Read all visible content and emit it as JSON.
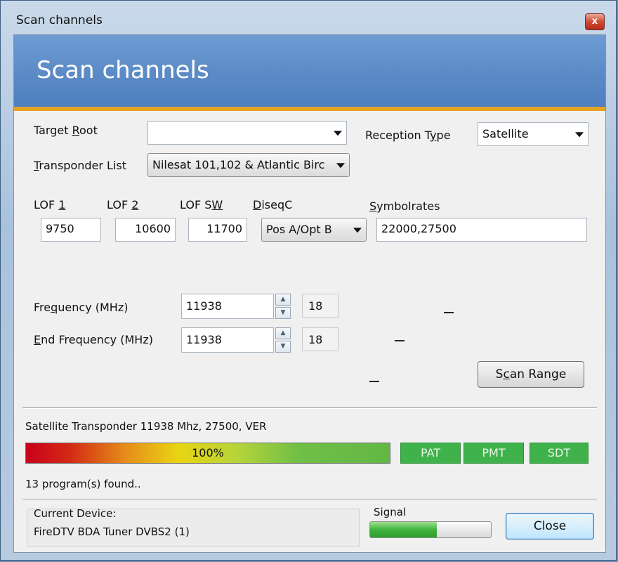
{
  "window": {
    "title": "Scan channels",
    "close_glyph": "x"
  },
  "banner": {
    "title": "Scan channels"
  },
  "target_root": {
    "label_pre": "Target ",
    "label_acc": "R",
    "label_post": "oot",
    "value": ""
  },
  "reception_type": {
    "label_pre": "Reception T",
    "label_acc": "y",
    "label_post": "pe",
    "value": "Satellite"
  },
  "transponder_list": {
    "label_pre": "",
    "label_acc": "T",
    "label_post": "ransponder List",
    "value": "Nilesat 101,102 & Atlantic Birc"
  },
  "lof1": {
    "label_pre": "LOF ",
    "label_acc": "1",
    "label_post": "",
    "value": "9750"
  },
  "lof2": {
    "label_pre": "LOF ",
    "label_acc": "2",
    "label_post": "",
    "value": "10600"
  },
  "lofsw": {
    "label_pre": "LOF S",
    "label_acc": "W",
    "label_post": "",
    "value": "11700"
  },
  "diseqc": {
    "label_pre": "",
    "label_acc": "D",
    "label_post": "iseqC",
    "value": "Pos A/Opt B"
  },
  "symbolrates": {
    "label_pre": "",
    "label_acc": "S",
    "label_post": "ymbolrates",
    "value": "22000,27500"
  },
  "frequency": {
    "label_pre": "Fre",
    "label_acc": "q",
    "label_post": "uency (MHz)",
    "value": "11938",
    "side_value": "18"
  },
  "end_frequency": {
    "label_pre": "",
    "label_acc": "E",
    "label_post": "nd  Frequency (MHz)",
    "value": "11938",
    "side_value": "18"
  },
  "dash_text": "–",
  "scan_range": {
    "label_pre": "S",
    "label_acc": "c",
    "label_post": "an Range"
  },
  "status": {
    "transponder_text": "Satellite Transponder 11938 Mhz, 27500, VER",
    "progress_label": "100%",
    "progress": 1.0,
    "found_text": "13 program(s) found.."
  },
  "tables": [
    "PAT",
    "PMT",
    "SDT"
  ],
  "device": {
    "title": "Current Device:",
    "name": "FireDTV BDA Tuner DVBS2 (1)"
  },
  "signal": {
    "label": "Signal",
    "level": 0.55
  },
  "close_button": {
    "label": "Close"
  }
}
